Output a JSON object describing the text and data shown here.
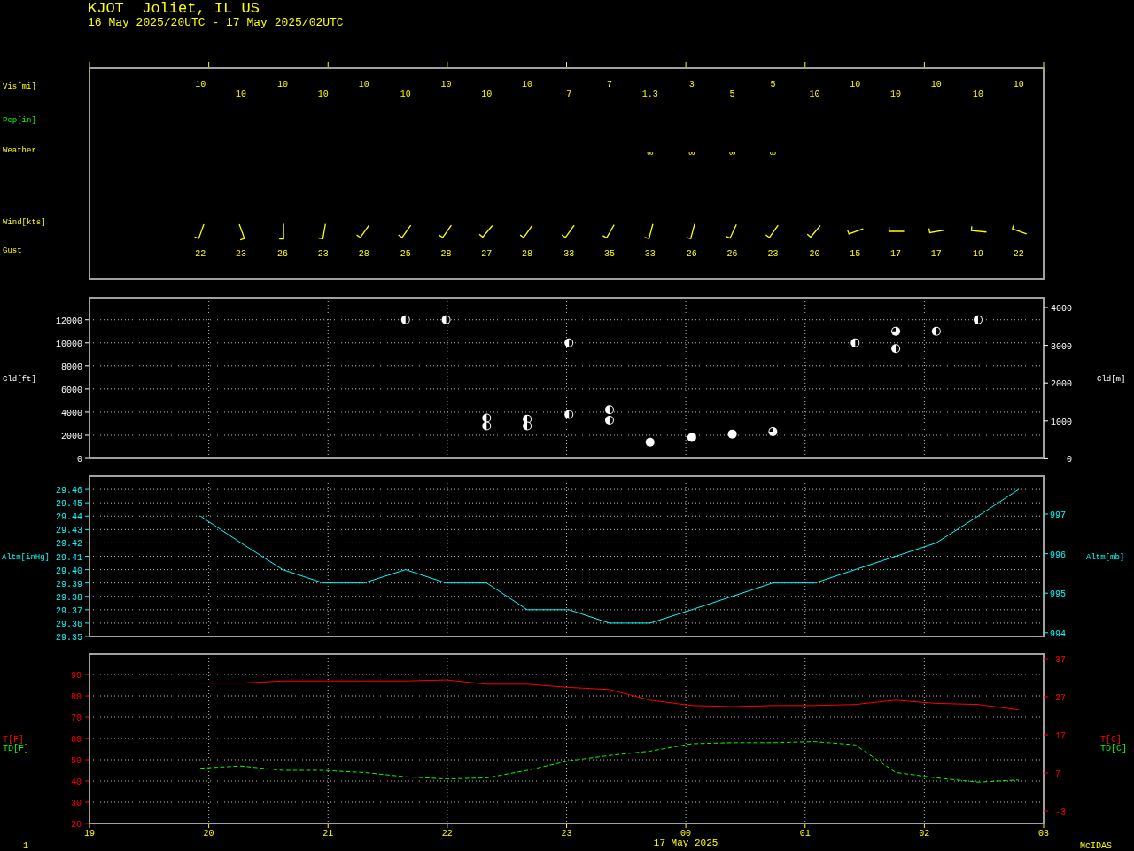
{
  "header": {
    "title": "KJOT  Joliet, IL US",
    "period": "16 May 2025/20UTC - 17 May 2025/02UTC"
  },
  "surface": {
    "labels": [
      {
        "text": "Vis[mi]",
        "kind": "vis"
      },
      {
        "text": "Pcp[in]",
        "kind": "pcp"
      },
      {
        "text": "Weather",
        "kind": "weather"
      },
      {
        "text": "Wind[kts]",
        "kind": "wind"
      },
      {
        "text": "Gust",
        "kind": "gust"
      }
    ],
    "observations": [
      {
        "vis": "10",
        "gust": "22"
      },
      {
        "vis": "10",
        "gust": "23"
      },
      {
        "vis": "10",
        "gust": "26"
      },
      {
        "vis": "10",
        "gust": "23"
      },
      {
        "vis": "10",
        "gust": "28"
      },
      {
        "vis": "10",
        "gust": "25"
      },
      {
        "vis": "10",
        "gust": "28"
      },
      {
        "vis": "10",
        "gust": "27"
      },
      {
        "vis": "10",
        "gust": "28"
      },
      {
        "vis": "7",
        "gust": "33"
      },
      {
        "vis": "7",
        "gust": "35"
      },
      {
        "vis": "1.3",
        "weather": "∞",
        "gust": "33"
      },
      {
        "vis": "3",
        "weather": "∞",
        "gust": "26"
      },
      {
        "vis": "5",
        "weather": "∞",
        "gust": "26"
      },
      {
        "vis": "5",
        "weather": "∞",
        "gust": "23"
      },
      {
        "vis": "10",
        "gust": "20"
      },
      {
        "vis": "10",
        "gust": "15"
      },
      {
        "vis": "10",
        "gust": "17"
      },
      {
        "vis": "10",
        "gust": "17"
      },
      {
        "vis": "10",
        "gust": "19"
      },
      {
        "vis": "10",
        "gust": "22"
      }
    ]
  },
  "clouds": {
    "right_axis": {
      "label": "Cld[m]",
      "ticks": [
        "4000",
        "3000",
        "2000",
        "1000",
        "0"
      ]
    },
    "symbols": [
      {
        "kind": "half"
      },
      {
        "kind": "half"
      },
      {
        "kind": "full"
      },
      {
        "kind": "three_quarter"
      }
    ],
    "chart_data": {
      "type": "scatter",
      "ylabel": "Cld[ft]",
      "grid": true,
      "x": [
        21.65,
        21.99,
        22.33,
        22.67,
        23.02,
        23.36,
        23.7,
        24.05,
        24.39,
        24.73,
        25.42,
        25.76,
        26.1,
        26.45
      ],
      "xlim": [
        19,
        27
      ],
      "ylim": [
        0,
        13900
      ],
      "yticks": [
        0,
        2000,
        4000,
        6000,
        8000,
        10000,
        12000
      ],
      "series": [
        {
          "color": "#ffffff",
          "values": [
            12000,
            12000,
            3500,
            3400,
            10000,
            4200,
            null,
            null,
            null,
            null,
            10000,
            9500,
            11000,
            12000
          ]
        },
        {
          "color": "#ffffff",
          "values": [
            null,
            null,
            2800,
            2800,
            3800,
            3300,
            null,
            null,
            null,
            null,
            null,
            null,
            null,
            null
          ]
        },
        {
          "color": "#ffffff",
          "values": [
            null,
            null,
            null,
            null,
            null,
            null,
            1400,
            1800,
            2100,
            null,
            null,
            null,
            null,
            null
          ]
        },
        {
          "color": "#ffffff",
          "values": [
            null,
            null,
            null,
            null,
            null,
            null,
            null,
            null,
            null,
            2300,
            null,
            11000,
            null,
            null
          ]
        }
      ]
    }
  },
  "altimeter": {
    "right_axis": {
      "label": "Altm[mb]",
      "ticks": [
        "997",
        "996",
        "995",
        "994"
      ]
    },
    "chart_data": {
      "type": "line",
      "ylabel": "Altm[inHg]",
      "grid": true,
      "x": [
        19.93,
        20.27,
        20.62,
        20.96,
        21.3,
        21.65,
        21.99,
        22.33,
        22.67,
        23.02,
        23.36,
        23.7,
        24.05,
        24.39,
        24.73,
        25.08,
        25.42,
        25.76,
        26.1,
        26.45,
        26.79
      ],
      "xlim": [
        19,
        27
      ],
      "ylim": [
        29.35,
        29.47
      ],
      "yticks": [
        29.35,
        29.36,
        29.37,
        29.38,
        29.39,
        {
          "value": 29.4,
          "label": "29.40"
        },
        29.41,
        29.42,
        29.43,
        29.44,
        29.45,
        29.46
      ],
      "series": [
        {
          "color": "#00ffff",
          "values": [
            29.44,
            29.42,
            29.4,
            29.39,
            29.39,
            29.4,
            29.39,
            29.39,
            29.37,
            29.37,
            29.36,
            29.36,
            29.37,
            29.38,
            29.39,
            29.39,
            29.4,
            29.41,
            29.42,
            29.44,
            29.46
          ]
        }
      ]
    }
  },
  "temperature": {
    "right_axis": {
      "labels": [
        {
          "text": "T[C]",
          "color": "#ff0000"
        },
        {
          "text": "TD[C]",
          "color": "#00ff00"
        }
      ],
      "ticks": [
        "37",
        "27",
        "17",
        "7",
        "-3"
      ]
    },
    "chart_data": {
      "type": "line",
      "grid": true,
      "x": [
        19.93,
        20.27,
        20.62,
        20.96,
        21.3,
        21.65,
        21.99,
        22.33,
        22.67,
        23.02,
        23.36,
        23.7,
        24.05,
        24.39,
        24.73,
        25.08,
        25.42,
        25.76,
        26.1,
        26.45,
        26.79
      ],
      "xlim": [
        19,
        27
      ],
      "xticks": [
        19,
        20,
        21,
        22,
        23
      ],
      "ylim": [
        20,
        99.6
      ],
      "yticks": [
        20,
        30,
        40,
        50,
        60,
        70,
        80,
        90
      ],
      "series": [
        {
          "name": "T[F]",
          "color": "#ff0000",
          "values": [
            86,
            86,
            87,
            87,
            87,
            87,
            87.5,
            85.5,
            85.5,
            84,
            83,
            78,
            75.5,
            75,
            75.5,
            75.5,
            76,
            78,
            76.5,
            76,
            73.5
          ]
        },
        {
          "name": "TD[F]",
          "color": "#00ff00",
          "line_style": "dashed",
          "values": [
            46,
            47,
            45,
            45,
            44,
            42,
            41,
            41.5,
            45,
            49.5,
            52,
            54,
            57.5,
            58,
            58,
            58.5,
            57,
            44,
            41.5,
            39.5,
            40.5
          ]
        }
      ]
    }
  },
  "time_axis": {
    "next_day_hours": [
      "00",
      "01",
      "02",
      "03"
    ],
    "date": "17 May 2025"
  },
  "footer": {
    "page": "1",
    "brand": "McIDAS"
  }
}
